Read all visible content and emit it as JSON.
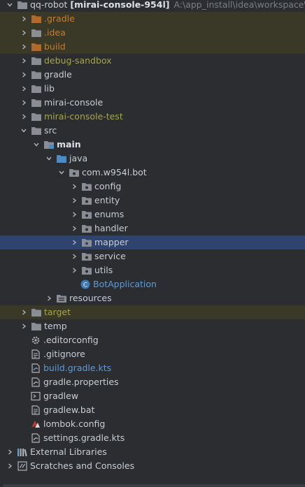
{
  "colors": {
    "background": "#2b2d30",
    "selected_row": "#2e436e",
    "excluded_row": "#3a3826",
    "excluded_text": "#c77d2f",
    "untracked_text": "#a9a449",
    "modified_text": "#5d9bd9",
    "folder_gray": "#8a8e94",
    "folder_blue": "#4a8bc8"
  },
  "project": {
    "name": "qq-robot",
    "module": "[mirai-console-954l]",
    "path": "A:\\app_install\\idea\\workspace\\qq-"
  },
  "items": [
    {
      "label": "qq-robot",
      "icon": "folder-icon"
    },
    {
      "label": ".gradle",
      "icon": "folder-excluded-icon"
    },
    {
      "label": ".idea",
      "icon": "folder-icon"
    },
    {
      "label": "build",
      "icon": "folder-excluded-icon"
    },
    {
      "label": "debug-sandbox",
      "icon": "folder-icon"
    },
    {
      "label": "gradle",
      "icon": "folder-icon"
    },
    {
      "label": "lib",
      "icon": "folder-icon"
    },
    {
      "label": "mirai-console",
      "icon": "folder-icon"
    },
    {
      "label": "mirai-console-test",
      "icon": "folder-icon"
    },
    {
      "label": "src",
      "icon": "folder-icon"
    },
    {
      "label": "main",
      "icon": "module-folder-icon"
    },
    {
      "label": "java",
      "icon": "source-folder-icon"
    },
    {
      "label": "com.w954l.bot",
      "icon": "package-icon"
    },
    {
      "label": "config",
      "icon": "package-icon"
    },
    {
      "label": "entity",
      "icon": "package-icon"
    },
    {
      "label": "enums",
      "icon": "package-icon"
    },
    {
      "label": "handler",
      "icon": "package-icon"
    },
    {
      "label": "mapper",
      "icon": "package-icon"
    },
    {
      "label": "service",
      "icon": "package-icon"
    },
    {
      "label": "utils",
      "icon": "package-icon"
    },
    {
      "label": "BotApplication",
      "icon": "java-class-icon"
    },
    {
      "label": "resources",
      "icon": "resources-folder-icon"
    },
    {
      "label": "target",
      "icon": "folder-icon"
    },
    {
      "label": "temp",
      "icon": "folder-icon"
    },
    {
      "label": ".editorconfig",
      "icon": "gear-icon"
    },
    {
      "label": ".gitignore",
      "icon": "text-file-icon"
    },
    {
      "label": "build.gradle.kts",
      "icon": "gradle-file-icon"
    },
    {
      "label": "gradle.properties",
      "icon": "gradle-file-icon"
    },
    {
      "label": "gradlew",
      "icon": "shell-file-icon"
    },
    {
      "label": "gradlew.bat",
      "icon": "text-file-icon"
    },
    {
      "label": "lombok.config",
      "icon": "lombok-icon"
    },
    {
      "label": "settings.gradle.kts",
      "icon": "gradle-file-icon"
    },
    {
      "label": "External Libraries",
      "icon": "libraries-icon"
    },
    {
      "label": "Scratches and Consoles",
      "icon": "scratches-icon"
    }
  ]
}
